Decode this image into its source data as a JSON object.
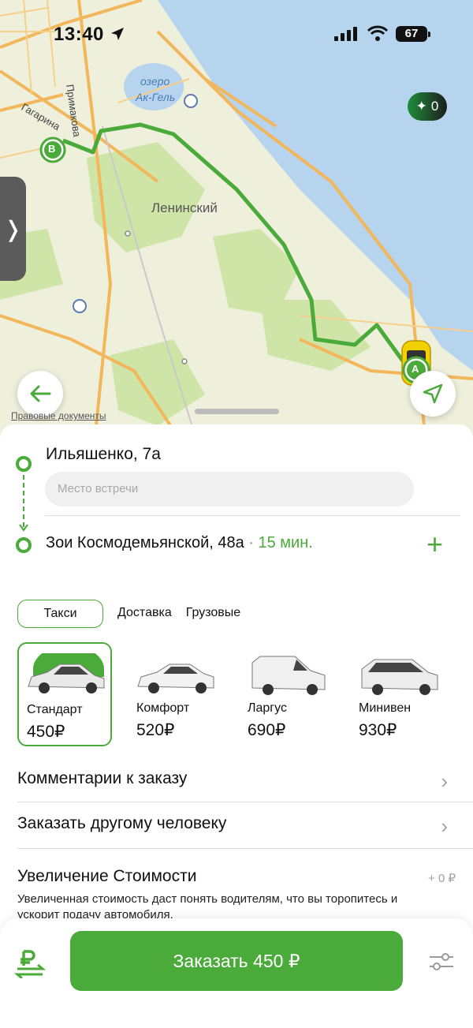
{
  "status_bar": {
    "time": "13:40",
    "battery": "67"
  },
  "map": {
    "labels": {
      "lake": "озеро",
      "lake_name": "Ак-Гель",
      "district": "Ленинский",
      "street_1": "Примакова",
      "street_2": "Гагарина"
    },
    "marker_b": "В",
    "marker_a": "А",
    "score_badge": "0",
    "legal_link": "Правовые документы",
    "colors": {
      "route": "#4aaa3a",
      "water": "#b7d4ee",
      "land": "#eef0dc",
      "park": "#cfe5a8",
      "road": "#f2b65b"
    }
  },
  "route": {
    "from": "Ильяшенко, 7а",
    "meeting_placeholder": "Место встречи",
    "to": "Зои Космодемьянской, 48а",
    "eta": " · 15 мин."
  },
  "tabs": [
    {
      "label": "Такси",
      "active": true
    },
    {
      "label": "Доставка",
      "active": false
    },
    {
      "label": "Грузовые",
      "active": false
    }
  ],
  "tariffs": [
    {
      "name": "Стандарт",
      "price": "450₽",
      "active": true
    },
    {
      "name": "Комфорт",
      "price": "520₽",
      "active": false
    },
    {
      "name": "Ларгус",
      "price": "690₽",
      "active": false
    },
    {
      "name": "Минивен",
      "price": "930₽",
      "active": false
    }
  ],
  "options": {
    "comments": "Комментарии к заказу",
    "order_for_other": "Заказать другому человеку",
    "price_increase_title": "Увеличение Стоимости",
    "price_increase_value": "+ 0 ₽",
    "price_increase_desc": "Увеличенная стоимость даст понять водителям, что вы торопитесь и ускорит подачу автомобиля."
  },
  "order_button": "Заказать 450 ₽",
  "accent_color": "#4aaa3a"
}
